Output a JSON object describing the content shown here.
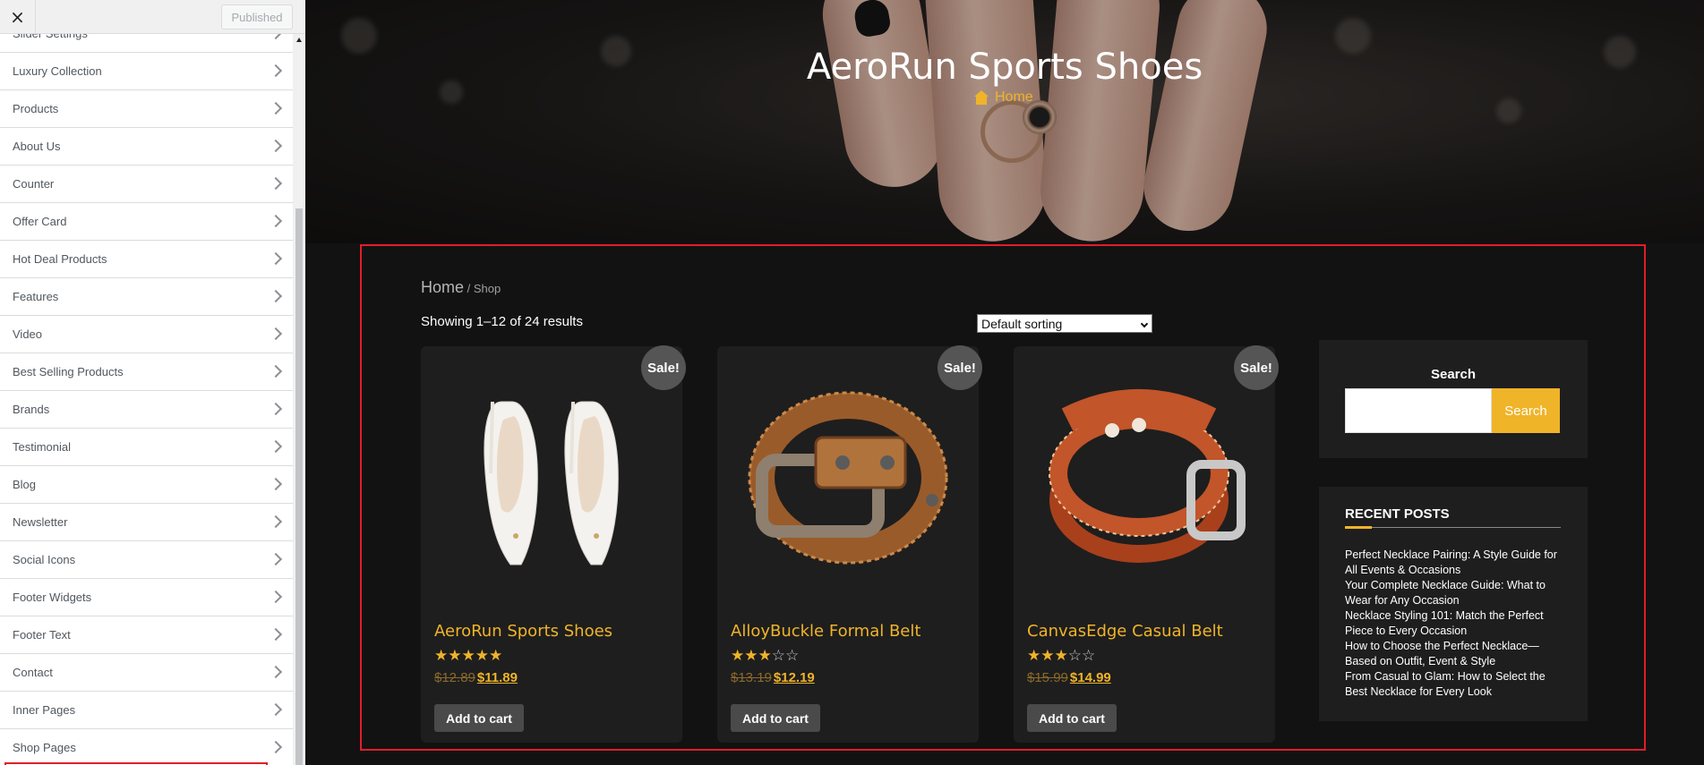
{
  "customizer": {
    "close_icon": "×",
    "publish_label": "Published",
    "sections": [
      {
        "label": "Slider Settings"
      },
      {
        "label": "Luxury Collection"
      },
      {
        "label": "Products"
      },
      {
        "label": "About Us"
      },
      {
        "label": "Counter"
      },
      {
        "label": "Offer Card"
      },
      {
        "label": "Hot Deal Products"
      },
      {
        "label": "Features"
      },
      {
        "label": "Video"
      },
      {
        "label": "Best Selling Products"
      },
      {
        "label": "Brands"
      },
      {
        "label": "Testimonial"
      },
      {
        "label": "Blog"
      },
      {
        "label": "Newsletter"
      },
      {
        "label": "Social Icons"
      },
      {
        "label": "Footer Widgets"
      },
      {
        "label": "Footer Text"
      },
      {
        "label": "Contact"
      },
      {
        "label": "Inner Pages"
      },
      {
        "label": "Shop Pages"
      }
    ],
    "highlighted_section": "Shop Pages"
  },
  "hero": {
    "title": "AeroRun Sports Shoes",
    "crumb": "Home"
  },
  "shop": {
    "breadcrumb_home": "Home",
    "breadcrumb_current": " / Shop",
    "result_count": "Showing 1–12 of 24 results",
    "sorting_selected": "Default sorting",
    "products": [
      {
        "name": "AeroRun Sports Shoes",
        "badge": "Sale!",
        "rating": 5,
        "old_price": "$12.89",
        "price": "$11.89",
        "button": "Add to cart",
        "image": "white-heels"
      },
      {
        "name": "AlloyBuckle Formal Belt",
        "badge": "Sale!",
        "rating": 3,
        "old_price": "$13.19",
        "price": "$12.19",
        "button": "Add to cart",
        "image": "tan-belt"
      },
      {
        "name": "CanvasEdge Casual Belt",
        "badge": "Sale!",
        "rating": 3,
        "old_price": "$15.99",
        "price": "$14.99",
        "button": "Add to cart",
        "image": "brown-belt"
      }
    ]
  },
  "sidebar_widgets": {
    "search_title": "Search",
    "search_placeholder": "",
    "search_button": "Search",
    "recent_title": "RECENT POSTS",
    "recent_posts": [
      "Perfect Necklace Pairing: A Style Guide for All Events & Occasions",
      "Your Complete Necklace Guide: What to Wear for Any Occasion",
      "Necklace Styling 101: Match the Perfect Piece to Every Occasion",
      "How to Choose the Perfect Necklace—Based on Outfit, Event & Style",
      "From Casual to Glam: How to Select the Best Necklace for Every Look"
    ]
  },
  "colors": {
    "accent": "#f0b429",
    "highlight": "#e11d2a",
    "page_bg": "#121212",
    "card_bg": "#1e1e1e"
  }
}
